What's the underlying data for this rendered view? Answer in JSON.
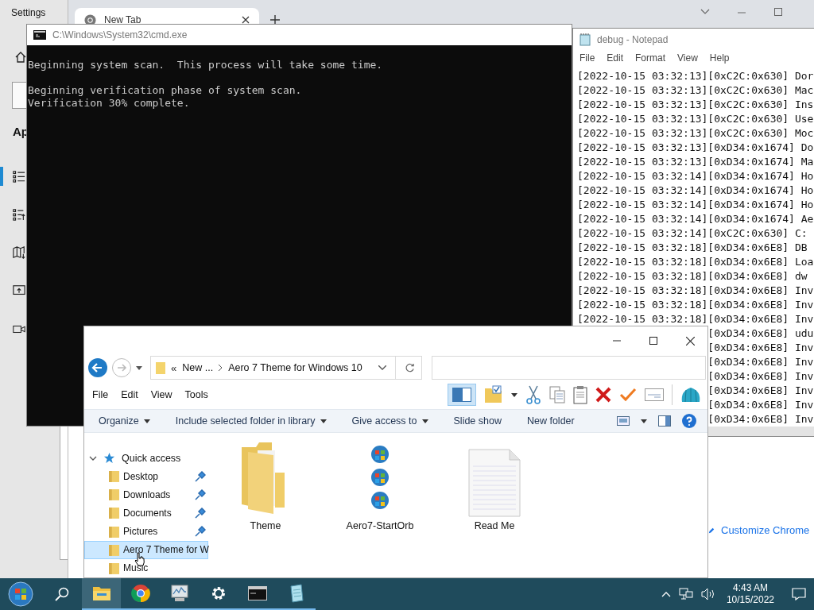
{
  "settings": {
    "title": "Settings",
    "heading": "Ap",
    "nav": [
      {
        "selected": true
      },
      {
        "selected": false
      },
      {
        "selected": false
      },
      {
        "selected": false
      },
      {
        "selected": false
      }
    ]
  },
  "chrome": {
    "tab_title": "New Tab",
    "customize_link": "Customize Chrome"
  },
  "cmd": {
    "title": "C:\\Windows\\System32\\cmd.exe",
    "lines": [
      {
        "text": "Beginning system scan.  This process will take some time.",
        "blank_before": false
      },
      {
        "text": "Beginning verification phase of system scan.",
        "blank_before": true
      },
      {
        "text": "Verification 30% complete.",
        "blank_before": false
      }
    ]
  },
  "notepad": {
    "title": "debug - Notepad",
    "menu": [
      "File",
      "Edit",
      "Format",
      "View",
      "Help"
    ],
    "lines": [
      "[2022-10-15 03:32:13][0xC2C:0x630] Dor",
      "[2022-10-15 03:32:13][0xC2C:0x630] Mac",
      "[2022-10-15 03:32:13][0xC2C:0x630] Ins",
      "[2022-10-15 03:32:13][0xC2C:0x630] Use",
      "[2022-10-15 03:32:13][0xC2C:0x630] Moc",
      "[2022-10-15 03:32:13][0xD34:0x1674] Do",
      "[2022-10-15 03:32:13][0xD34:0x1674] Ma",
      "[2022-10-15 03:32:14][0xD34:0x1674] Ho",
      "[2022-10-15 03:32:14][0xD34:0x1674] Ho",
      "[2022-10-15 03:32:14][0xD34:0x1674] Ho",
      "[2022-10-15 03:32:14][0xD34:0x1674] Ae",
      "[2022-10-15 03:32:14][0xC2C:0x630] C:",
      "[2022-10-15 03:32:18][0xD34:0x6E8] DB",
      "[2022-10-15 03:32:18][0xD34:0x6E8] Loa",
      "[2022-10-15 03:32:18][0xD34:0x6E8] dw",
      "[2022-10-15 03:32:18][0xD34:0x6E8] Inv",
      "[2022-10-15 03:32:18][0xD34:0x6E8] Inv",
      "[2022-10-15 03:32:18][0xD34:0x6E8] Inv"
    ],
    "covered_lines": [
      "[0xD34:0x6E8] udu",
      "[0xD34:0x6E8] Inv",
      "[0xD34:0x6E8] Inv",
      "[0xD34:0x6E8] Inv",
      "[0xD34:0x6E8] Inv",
      "[0xD34:0x6E8] Inv",
      "[0xD34:0x6E8] Inv"
    ]
  },
  "explorer": {
    "breadcrumb_overflow": "«",
    "breadcrumb": [
      "New ...",
      "Aero 7 Theme for Windows 10"
    ],
    "menu": [
      "File",
      "Edit",
      "View",
      "Tools"
    ],
    "preview_pane_on": true,
    "commands": [
      {
        "label": "Organize",
        "dropdown": true
      },
      {
        "label": "Include selected folder in library",
        "dropdown": true
      },
      {
        "label": "Give access to",
        "dropdown": true
      },
      {
        "label": "Slide show",
        "dropdown": false
      },
      {
        "label": "New folder",
        "dropdown": false
      }
    ],
    "nav": {
      "label": "Quick access",
      "expanded": true,
      "children": [
        {
          "label": "Desktop",
          "pinned": true,
          "selected": false
        },
        {
          "label": "Downloads",
          "pinned": true,
          "selected": false
        },
        {
          "label": "Documents",
          "pinned": true,
          "selected": false
        },
        {
          "label": "Pictures",
          "pinned": true,
          "selected": false
        },
        {
          "label": "Aero 7 Theme for W",
          "pinned": false,
          "selected": true
        },
        {
          "label": "Music",
          "pinned": false,
          "selected": false
        }
      ]
    },
    "files": [
      {
        "name": "Theme",
        "kind": "folder"
      },
      {
        "name": "Aero7-StartOrb",
        "kind": "image"
      },
      {
        "name": "Read Me",
        "kind": "text"
      }
    ]
  },
  "taskbar": {
    "apps": [
      {
        "active": true
      },
      {
        "active": false
      },
      {
        "active": false
      },
      {
        "active": false
      },
      {
        "active": false
      },
      {
        "active": false
      }
    ],
    "time": "4:43 AM",
    "date": "10/15/2022"
  }
}
